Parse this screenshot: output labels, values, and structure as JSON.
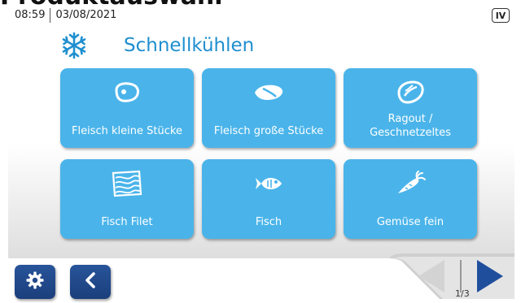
{
  "caption": "Produktauswahl",
  "status": {
    "time": "08:59",
    "date": "03/08/2021",
    "level": "IV"
  },
  "header": {
    "title": "Schnellkühlen",
    "icon": "snowflake-icon"
  },
  "tiles": [
    {
      "label": "Fleisch kleine Stücke",
      "icon": "small-meat-icon"
    },
    {
      "label": "Fleisch große Stücke",
      "icon": "large-meat-icon"
    },
    {
      "label_line1": "Ragout /",
      "label_line2": "Geschnetzeltes",
      "icon": "ragout-icon"
    },
    {
      "label": "Fisch Filet",
      "icon": "fish-fillet-icon"
    },
    {
      "label": "Fisch",
      "icon": "fish-icon"
    },
    {
      "label": "Gemüse fein",
      "icon": "carrot-icon"
    }
  ],
  "footer": {
    "settings_icon": "gear-icon",
    "back_icon": "chevron-left-icon",
    "page_indicator": "1/3"
  },
  "colors": {
    "tile": "#4ab4ea",
    "title": "#1f8fd0",
    "nav_button": "#1f4687",
    "arrow_next": "#1f4f9c",
    "arrow_prev_disabled": "#d6d6d6"
  }
}
